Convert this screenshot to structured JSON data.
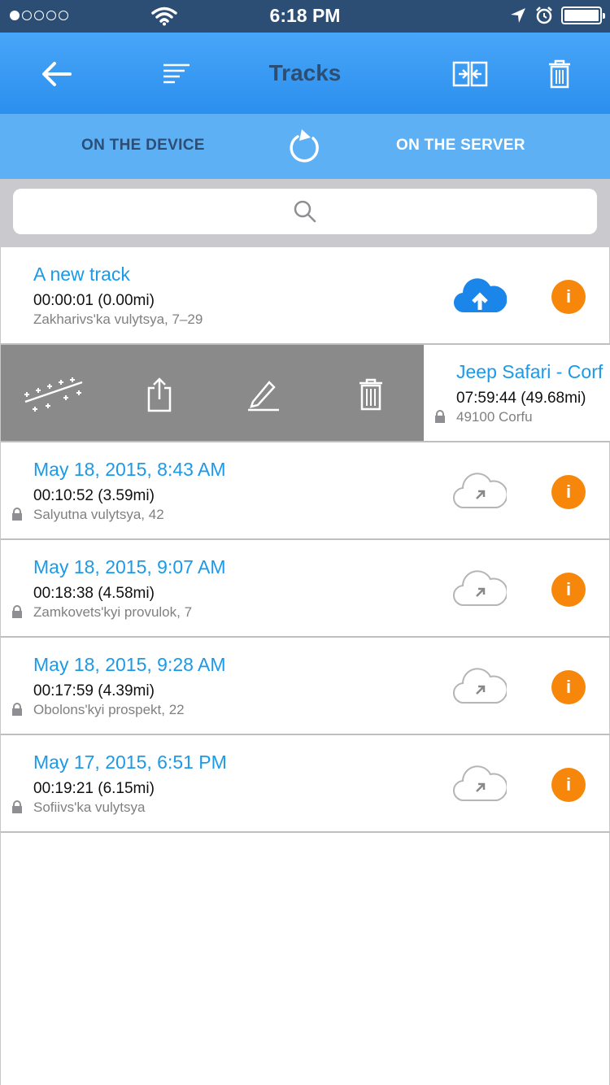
{
  "status_bar": {
    "time": "6:18 PM"
  },
  "nav": {
    "title": "Tracks"
  },
  "segments": {
    "device": "ON THE DEVICE",
    "server": "ON THE SERVER"
  },
  "search": {
    "placeholder": ""
  },
  "tracks": [
    {
      "title": "A new track",
      "duration": "00:00:01 (0.00mi)",
      "address": "Zakharivs'ka vulytsya, 7–29",
      "locked": false,
      "cloud": "upload-filled",
      "info": "i"
    },
    {
      "title": "Jeep Safari - Corf",
      "duration": "07:59:44 (49.68mi)",
      "address": "49100 Corfu",
      "locked": true,
      "swiped": true
    },
    {
      "title": "May 18, 2015, 8:43 AM",
      "duration": "00:10:52 (3.59mi)",
      "address": "Salyutna vulytsya, 42",
      "locked": true,
      "cloud": "outline",
      "info": "i"
    },
    {
      "title": "May 18, 2015, 9:07 AM",
      "duration": "00:18:38 (4.58mi)",
      "address": "Zamkovets'kyi provulok, 7",
      "locked": true,
      "cloud": "outline",
      "info": "i"
    },
    {
      "title": "May 18, 2015, 9:28 AM",
      "duration": "00:17:59 (4.39mi)",
      "address": "Obolons'kyi prospekt, 22",
      "locked": true,
      "cloud": "outline",
      "info": "i"
    },
    {
      "title": "May 17, 2015, 6:51 PM",
      "duration": "00:19:21 (6.15mi)",
      "address": "Sofiivs'ka vulytsya",
      "locked": true,
      "cloud": "outline",
      "info": "i"
    }
  ],
  "colors": {
    "nav": "#2b8fee",
    "segment": "#5eb0f5",
    "title_blue": "#1a9ae8",
    "info_orange": "#f7870b",
    "swipe_gray": "#8a8a8a"
  }
}
